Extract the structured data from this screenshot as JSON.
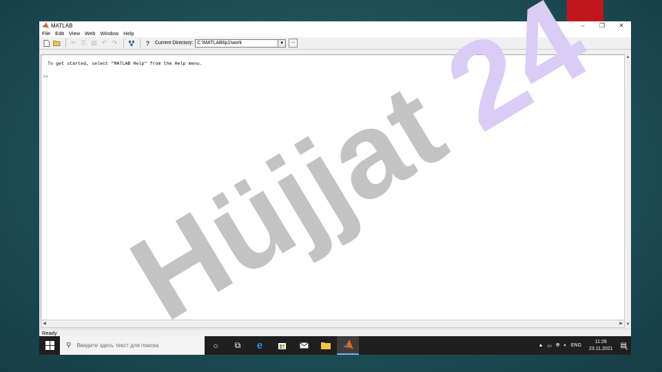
{
  "window": {
    "title": "MATLAB",
    "minimize_icon": "minimize-icon",
    "restore_icon": "restore-icon",
    "close_icon": "close-icon"
  },
  "menu": [
    "File",
    "Edit",
    "View",
    "Web",
    "Window",
    "Help"
  ],
  "toolbar": {
    "current_directory_label": "Current Directory:",
    "current_directory_value": "C:\\MATLAB6p1\\work",
    "help_symbol": "?",
    "browse_symbol": "..."
  },
  "command_window": {
    "intro": "To get started, select \"MATLAB Help\" from the Help menu.",
    "prompt": ">>"
  },
  "status": "Ready",
  "taskbar": {
    "search_placeholder": "Введите здесь текст для поиска",
    "language": "ENG",
    "time": "11:28",
    "date": "23.11.2021",
    "notification_count": "5"
  },
  "watermark": "Hüjjat 24"
}
